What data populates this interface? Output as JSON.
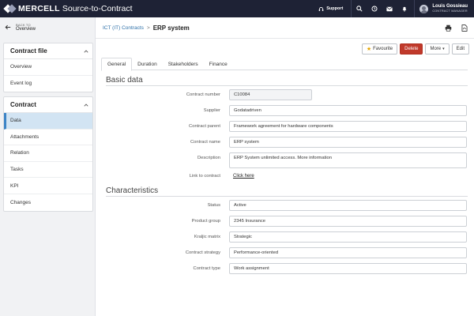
{
  "header": {
    "brand": "MERCELL",
    "product": "Source-to-Contract",
    "support_label": "Support",
    "user": {
      "name": "Louis Gossieau",
      "role": "CONTRACT MANAGER"
    }
  },
  "sidebar": {
    "back_small": "BACK TO",
    "back_label": "Overview",
    "contract_file": {
      "title": "Contract file",
      "items": [
        {
          "label": "Overview"
        },
        {
          "label": "Event log"
        }
      ]
    },
    "contract": {
      "title": "Contract",
      "items": [
        {
          "label": "Data",
          "active": true
        },
        {
          "label": "Attachments"
        },
        {
          "label": "Relation"
        },
        {
          "label": "Tasks"
        },
        {
          "label": "KPI"
        },
        {
          "label": "Changes"
        }
      ]
    }
  },
  "breadcrumb": {
    "parent": "ICT (IT) Contracts",
    "separator": ">",
    "current": "ERP system"
  },
  "actions": {
    "favourite": "Favourite",
    "delete": "Delete",
    "more": "More",
    "edit": "Edit"
  },
  "tabs": [
    {
      "label": "General",
      "active": true
    },
    {
      "label": "Duration"
    },
    {
      "label": "Stakeholders"
    },
    {
      "label": "Finance"
    }
  ],
  "basic_data": {
    "title": "Basic data",
    "contract_number": {
      "label": "Contract number",
      "value": "C10084"
    },
    "supplier": {
      "label": "Supplier",
      "value": "Godatadriven"
    },
    "contract_parent": {
      "label": "Contract parent",
      "value": "Framework agreement for hardware components"
    },
    "contract_name": {
      "label": "Contract name",
      "value": "ERP system"
    },
    "description": {
      "label": "Description",
      "value": "ERP System unlimited access. More information"
    },
    "link_to_contract": {
      "label": "Link to contract",
      "value": "Click here"
    }
  },
  "characteristics": {
    "title": "Characteristics",
    "status": {
      "label": "Status",
      "value": "Active"
    },
    "product_group": {
      "label": "Product group",
      "value": "2345 Insurance"
    },
    "kraljic_matrix": {
      "label": "Kraljic matrix",
      "value": "Strategic"
    },
    "contract_strategy": {
      "label": "Contract strategy",
      "value": "Performance-oriented"
    },
    "contract_type": {
      "label": "Contract type",
      "value": "Work assignment"
    }
  },
  "colors": {
    "topbar": "#1e2235",
    "accent": "#3c84c6",
    "danger": "#c0392b",
    "link": "#2c6fa8"
  }
}
